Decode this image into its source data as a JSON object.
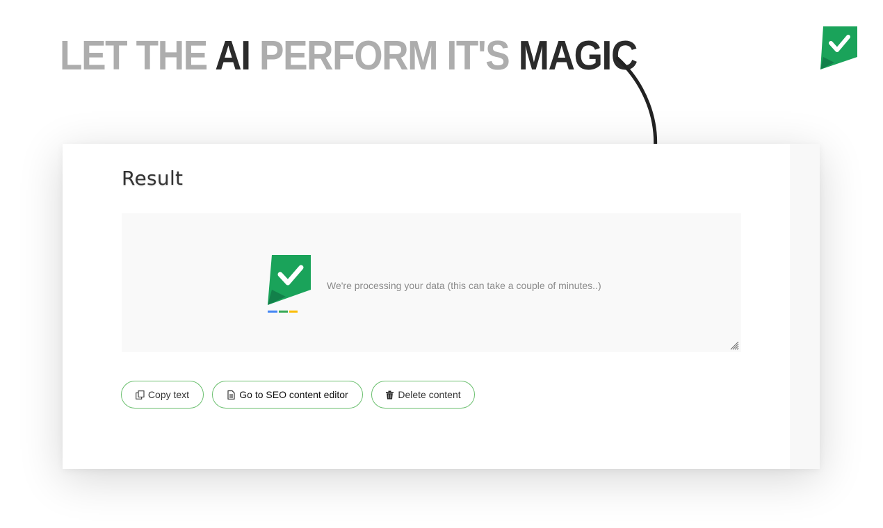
{
  "headline": {
    "part1": "LET THE ",
    "part2": "AI",
    "part3": " PERFORM IT'S ",
    "part4": "MAGIC"
  },
  "result": {
    "title": "Result",
    "processing_message": "We're processing your data (this can take a couple of minutes..)"
  },
  "actions": {
    "copy_label": "Copy text",
    "seo_editor_label": "Go to SEO content editor",
    "delete_label": "Delete content"
  },
  "icons": {
    "brand": "check-flag-logo-icon",
    "arrow": "curved-arrow-icon",
    "copy": "copy-icon",
    "document": "document-icon",
    "trash": "trash-icon",
    "resize": "resize-handle-icon"
  },
  "colors": {
    "brand_green": "#1aa35a",
    "brand_green_dark": "#12804a",
    "button_border": "#6abf6e",
    "headline_light": "#adadad",
    "headline_dark": "#2b2b2b",
    "loader_blue": "#4285f4",
    "loader_green": "#34a853",
    "loader_yellow": "#fbbc05"
  }
}
